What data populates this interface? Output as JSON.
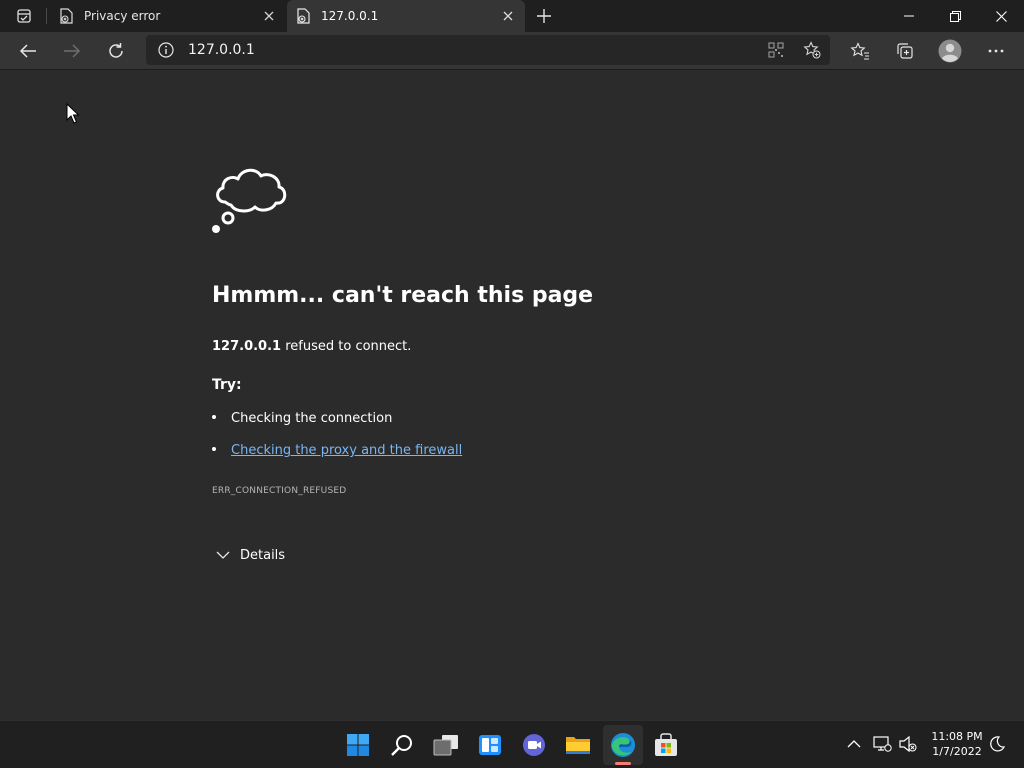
{
  "tabs": [
    {
      "title": "Privacy error",
      "active": false
    },
    {
      "title": "127.0.0.1",
      "active": true
    }
  ],
  "toolbar": {
    "url": "127.0.0.1"
  },
  "page": {
    "heading": "Hmmm... can't reach this page",
    "message_host": "127.0.0.1",
    "message_rest": " refused to connect.",
    "try_label": "Try:",
    "suggestions": [
      {
        "text": "Checking the connection",
        "link": false
      },
      {
        "text": "Checking the proxy and the firewall",
        "link": true
      }
    ],
    "error_code": "ERR_CONNECTION_REFUSED",
    "details_label": "Details"
  },
  "taskbar": {
    "time": "11:08 PM",
    "date": "1/7/2022",
    "apps": [
      "start-icon",
      "search-icon",
      "task-view-icon",
      "widgets-icon",
      "chat-icon",
      "file-explorer-icon",
      "edge-icon",
      "store-icon"
    ]
  },
  "colors": {
    "page_bg": "#2b2b2b",
    "tabstrip_bg": "#1f1f1f",
    "toolbar_bg": "#353535",
    "link": "#7bb5f2",
    "taskbar_bg": "#202020"
  }
}
